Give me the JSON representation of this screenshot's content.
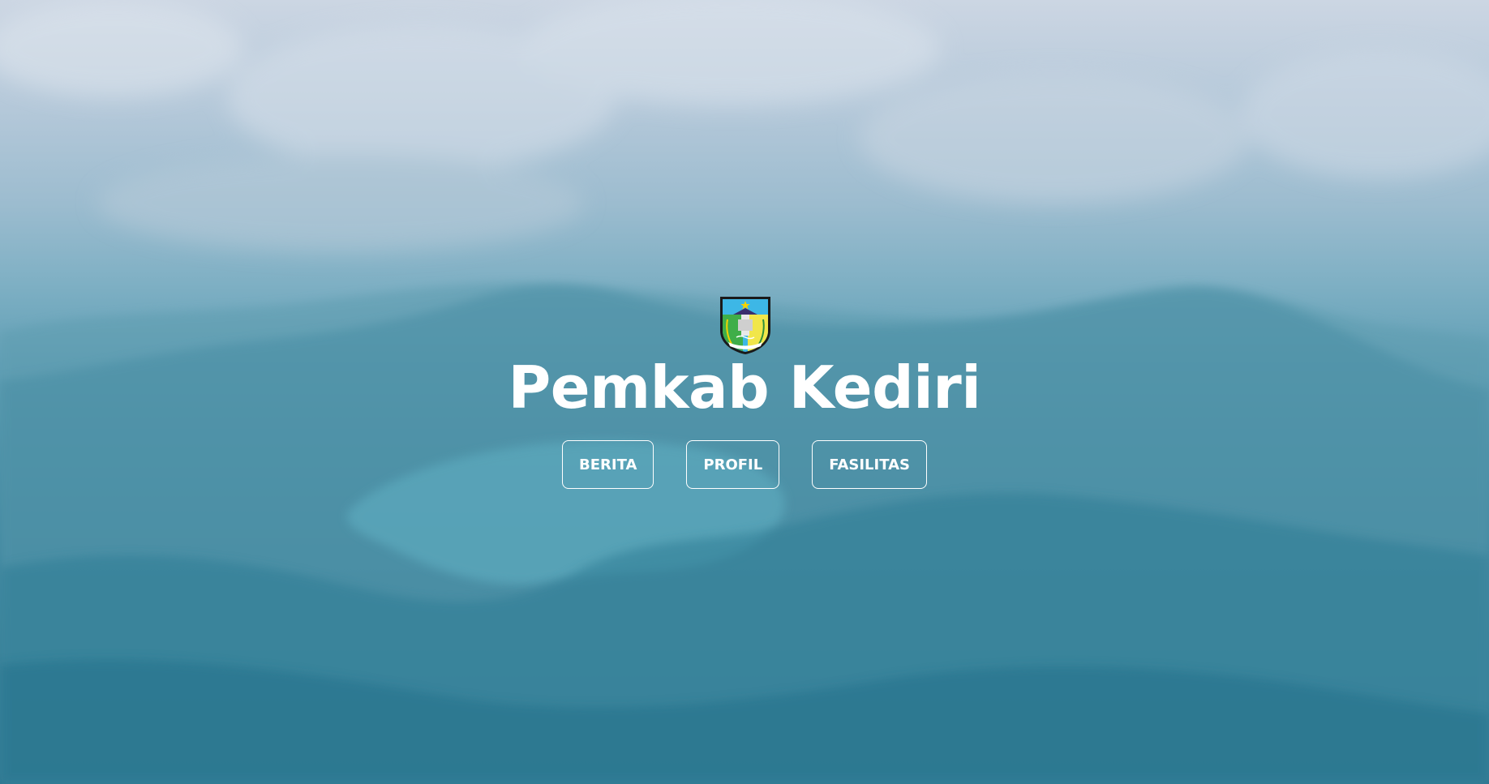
{
  "site": {
    "title": "Pemkab Kediri",
    "logo_icon": "kediri-regency-crest-icon"
  },
  "nav": {
    "items": [
      {
        "label": "BERITA"
      },
      {
        "label": "PROFIL"
      },
      {
        "label": "FASILITAS"
      }
    ]
  },
  "background": {
    "scene": "crater-lake-mountain-landscape",
    "sky_color": "#ccd6e3",
    "overlay_color": "#3f87a0",
    "lake_color": "#5aa6ba"
  },
  "colors": {
    "text": "#ffffff",
    "button_border": "#ffffff"
  }
}
